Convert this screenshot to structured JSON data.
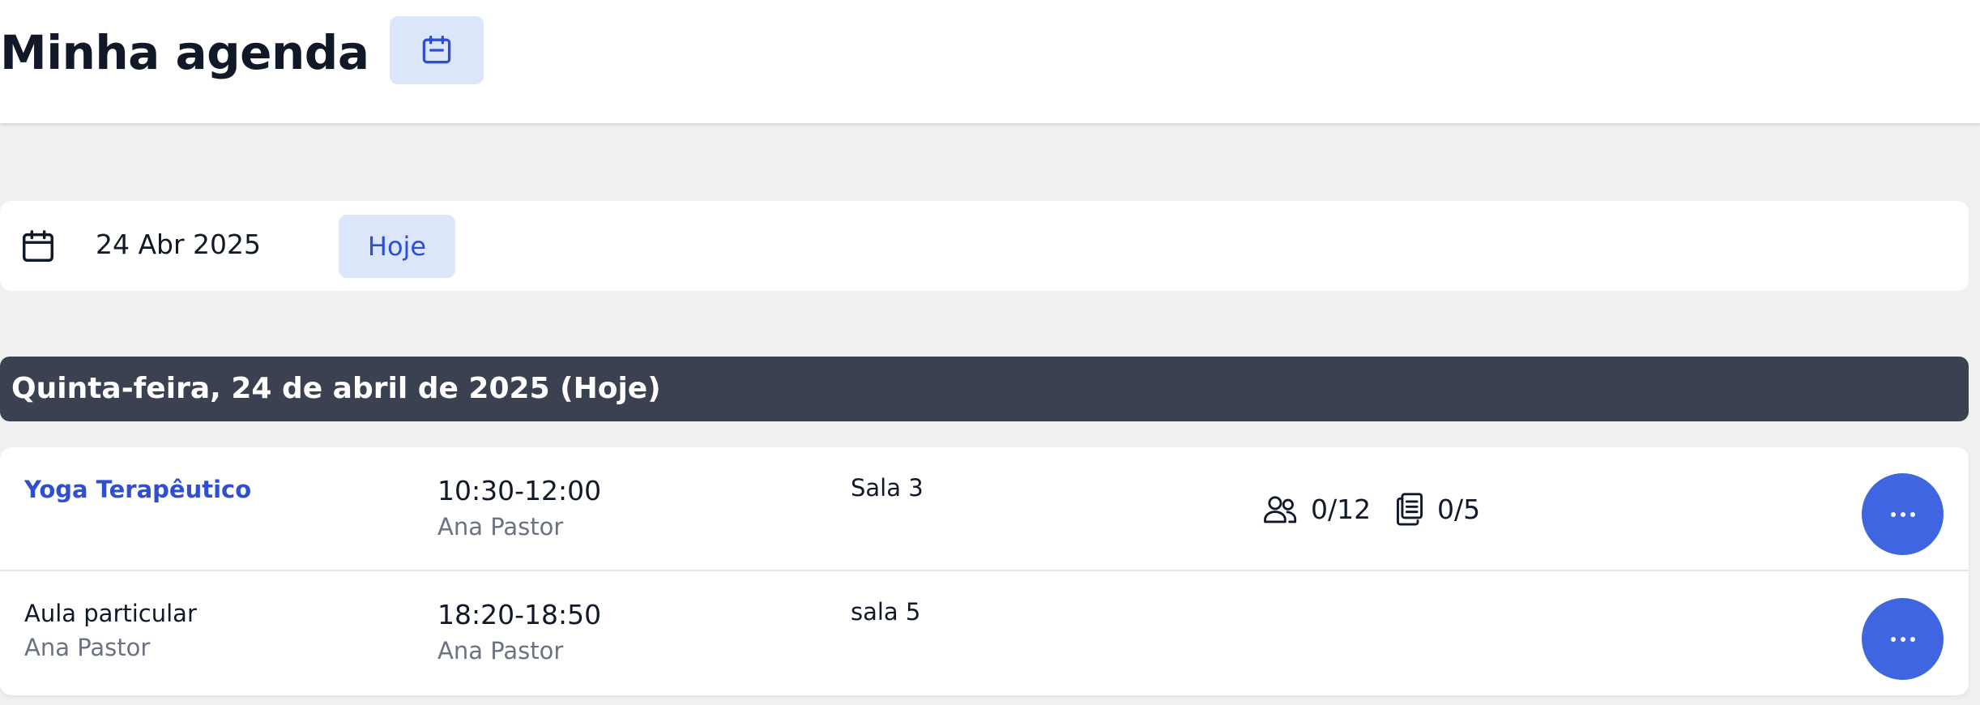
{
  "header": {
    "title": "Minha agenda",
    "calendar_button_icon": "calendar-icon"
  },
  "date_bar": {
    "icon": "calendar-icon",
    "date": "24 Abr 2025",
    "today_label": "Hoje"
  },
  "day": {
    "heading": "Quinta-feira, 24 de abril de 2025 (Hoje)"
  },
  "events": [
    {
      "name": "Yoga Terapêutico",
      "time": "10:30-12:00",
      "teacher": "Ana Pastor",
      "room": "Sala 3",
      "participants": "0/12",
      "waitlist": "0/5",
      "more_icon": "more-horizontal-icon"
    },
    {
      "name": "Aula particular",
      "subtitle": "Ana Pastor",
      "time": "18:20-18:50",
      "teacher": "Ana Pastor",
      "room": "sala 5",
      "more_icon": "more-horizontal-icon"
    }
  ],
  "colors": {
    "accent": "#2f4fd0",
    "button_bg": "#dbe6fb",
    "day_header_bg": "#3a4252",
    "more_button": "#3f66e0"
  }
}
